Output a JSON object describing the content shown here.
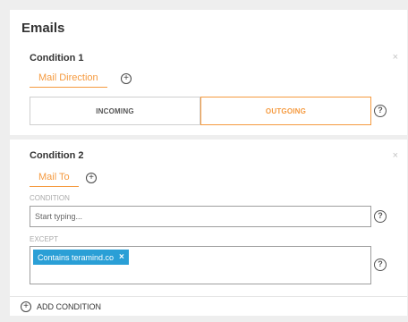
{
  "page": {
    "title": "Emails"
  },
  "conditions": [
    {
      "title": "Condition 1",
      "close": "×",
      "tab": "Mail Direction",
      "add": "+",
      "options": [
        "INCOMING",
        "OUTGOING"
      ],
      "selected": "OUTGOING",
      "help": "?"
    },
    {
      "title": "Condition 2",
      "close": "×",
      "tab": "Mail To",
      "add": "+",
      "condition_label": "CONDITION",
      "condition_placeholder": "Start typing...",
      "except_label": "EXCEPT",
      "except_tags": [
        "Contains teramind.co"
      ],
      "tag_remove": "×",
      "help": "?"
    }
  ],
  "footer": {
    "add_icon": "+",
    "add_label": "ADD CONDITION"
  },
  "colors": {
    "accent": "#f59a3f",
    "tag": "#2a9fd6",
    "background": "#eeeeee"
  }
}
